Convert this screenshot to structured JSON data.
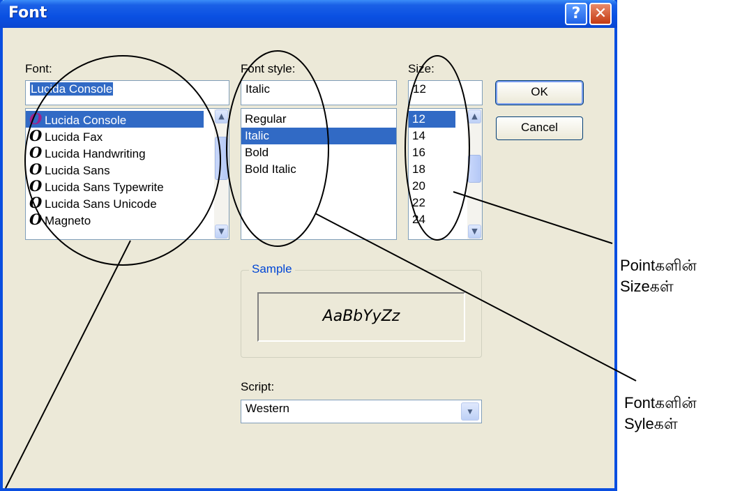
{
  "window": {
    "title": "Font",
    "help_label": "?",
    "close_label": "✕"
  },
  "font": {
    "label": "Font:",
    "value": "Lucida Console",
    "items": [
      {
        "label": "Lucida Console",
        "selected": true
      },
      {
        "label": "Lucida Fax"
      },
      {
        "label": "Lucida Handwriting"
      },
      {
        "label": "Lucida Sans"
      },
      {
        "label": "Lucida Sans Typewrite"
      },
      {
        "label": "Lucida Sans Unicode"
      },
      {
        "label": "Magneto"
      }
    ]
  },
  "style": {
    "label": "Font style:",
    "value": "Italic",
    "items": [
      "Regular",
      "Italic",
      "Bold",
      "Bold Italic"
    ]
  },
  "size": {
    "label": "Size:",
    "value": "12",
    "items": [
      "12",
      "14",
      "16",
      "18",
      "20",
      "22",
      "24"
    ]
  },
  "buttons": {
    "ok": "OK",
    "cancel": "Cancel"
  },
  "sample": {
    "legend": "Sample",
    "text": "AaBbYyZz"
  },
  "script": {
    "label": "Script:",
    "value": "Western"
  },
  "annotations": {
    "size_line1": "Pointகளின்",
    "size_line2": "Sizeகள்",
    "style_line1": "Fontகளின்",
    "style_line2": "Syleகள்"
  },
  "colors": {
    "titlebar": "#0a50e2",
    "selection": "#316ac5",
    "dialog_bg": "#ece9d8",
    "sample_legend": "#0046d5"
  }
}
